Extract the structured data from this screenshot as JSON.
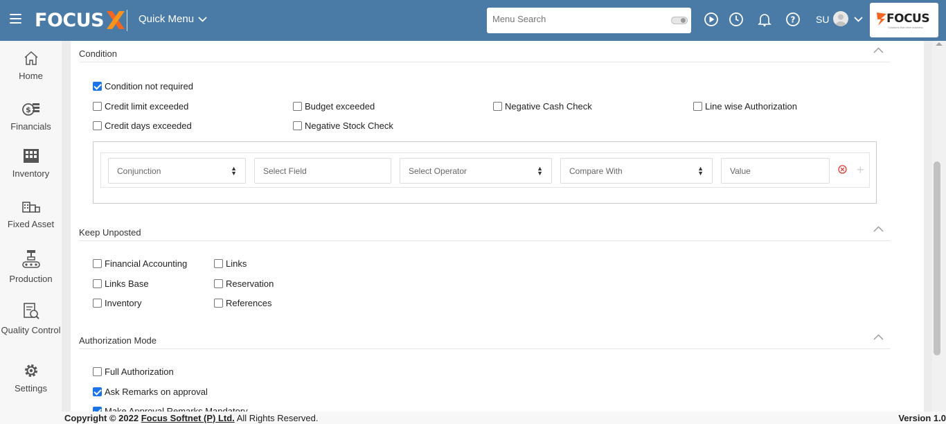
{
  "header": {
    "logo_text": "FOCUS",
    "quick_menu_label": "Quick Menu",
    "search_placeholder": "Menu Search",
    "user_initials": "SU",
    "brand_text": "FOCUS",
    "brand_tagline": "Solutions that drive business"
  },
  "sidebar": {
    "items": [
      {
        "label": "Home",
        "icon": "home-icon"
      },
      {
        "label": "Financials",
        "icon": "financials-icon"
      },
      {
        "label": "Inventory",
        "icon": "inventory-icon"
      },
      {
        "label": "Fixed Asset",
        "icon": "fixed-asset-icon"
      },
      {
        "label": "Production",
        "icon": "production-icon"
      },
      {
        "label": "Quality Control",
        "icon": "quality-control-icon"
      },
      {
        "label": "Settings",
        "icon": "settings-icon"
      }
    ]
  },
  "condition": {
    "title": "Condition",
    "options": [
      {
        "label": "Condition not required",
        "checked": true
      },
      {
        "label": "Credit limit exceeded",
        "checked": false
      },
      {
        "label": "Budget exceeded",
        "checked": false
      },
      {
        "label": "Negative Cash Check",
        "checked": false
      },
      {
        "label": "Line wise Authorization",
        "checked": false
      },
      {
        "label": "Credit days exceeded",
        "checked": false
      },
      {
        "label": "Negative Stock Check",
        "checked": false
      }
    ],
    "row": {
      "conjunction_placeholder": "Conjunction",
      "field_placeholder": "Select Field",
      "operator_placeholder": "Select Operator",
      "compare_placeholder": "Compare With",
      "value_placeholder": "Value"
    }
  },
  "keep_unposted": {
    "title": "Keep Unposted",
    "options": [
      {
        "label": "Financial Accounting",
        "checked": false
      },
      {
        "label": "Links",
        "checked": false
      },
      {
        "label": "Links Base",
        "checked": false
      },
      {
        "label": "Reservation",
        "checked": false
      },
      {
        "label": "Inventory",
        "checked": false
      },
      {
        "label": "References",
        "checked": false
      }
    ]
  },
  "authorization_mode": {
    "title": "Authorization Mode",
    "options": [
      {
        "label": "Full Authorization",
        "checked": false
      },
      {
        "label": "Ask Remarks on approval",
        "checked": true
      },
      {
        "label": "Make Approval Remarks Mandatory",
        "checked": true
      }
    ]
  },
  "footer": {
    "copyright_prefix": "Copyright © 2022",
    "company": "Focus Softnet (P) Ltd.",
    "rights": "All Rights Reserved.",
    "version": "Version 1.0"
  },
  "colors": {
    "topbar": "#4a7ba6",
    "accent": "#1a73e8",
    "logo_x_orange": "#f26522"
  }
}
